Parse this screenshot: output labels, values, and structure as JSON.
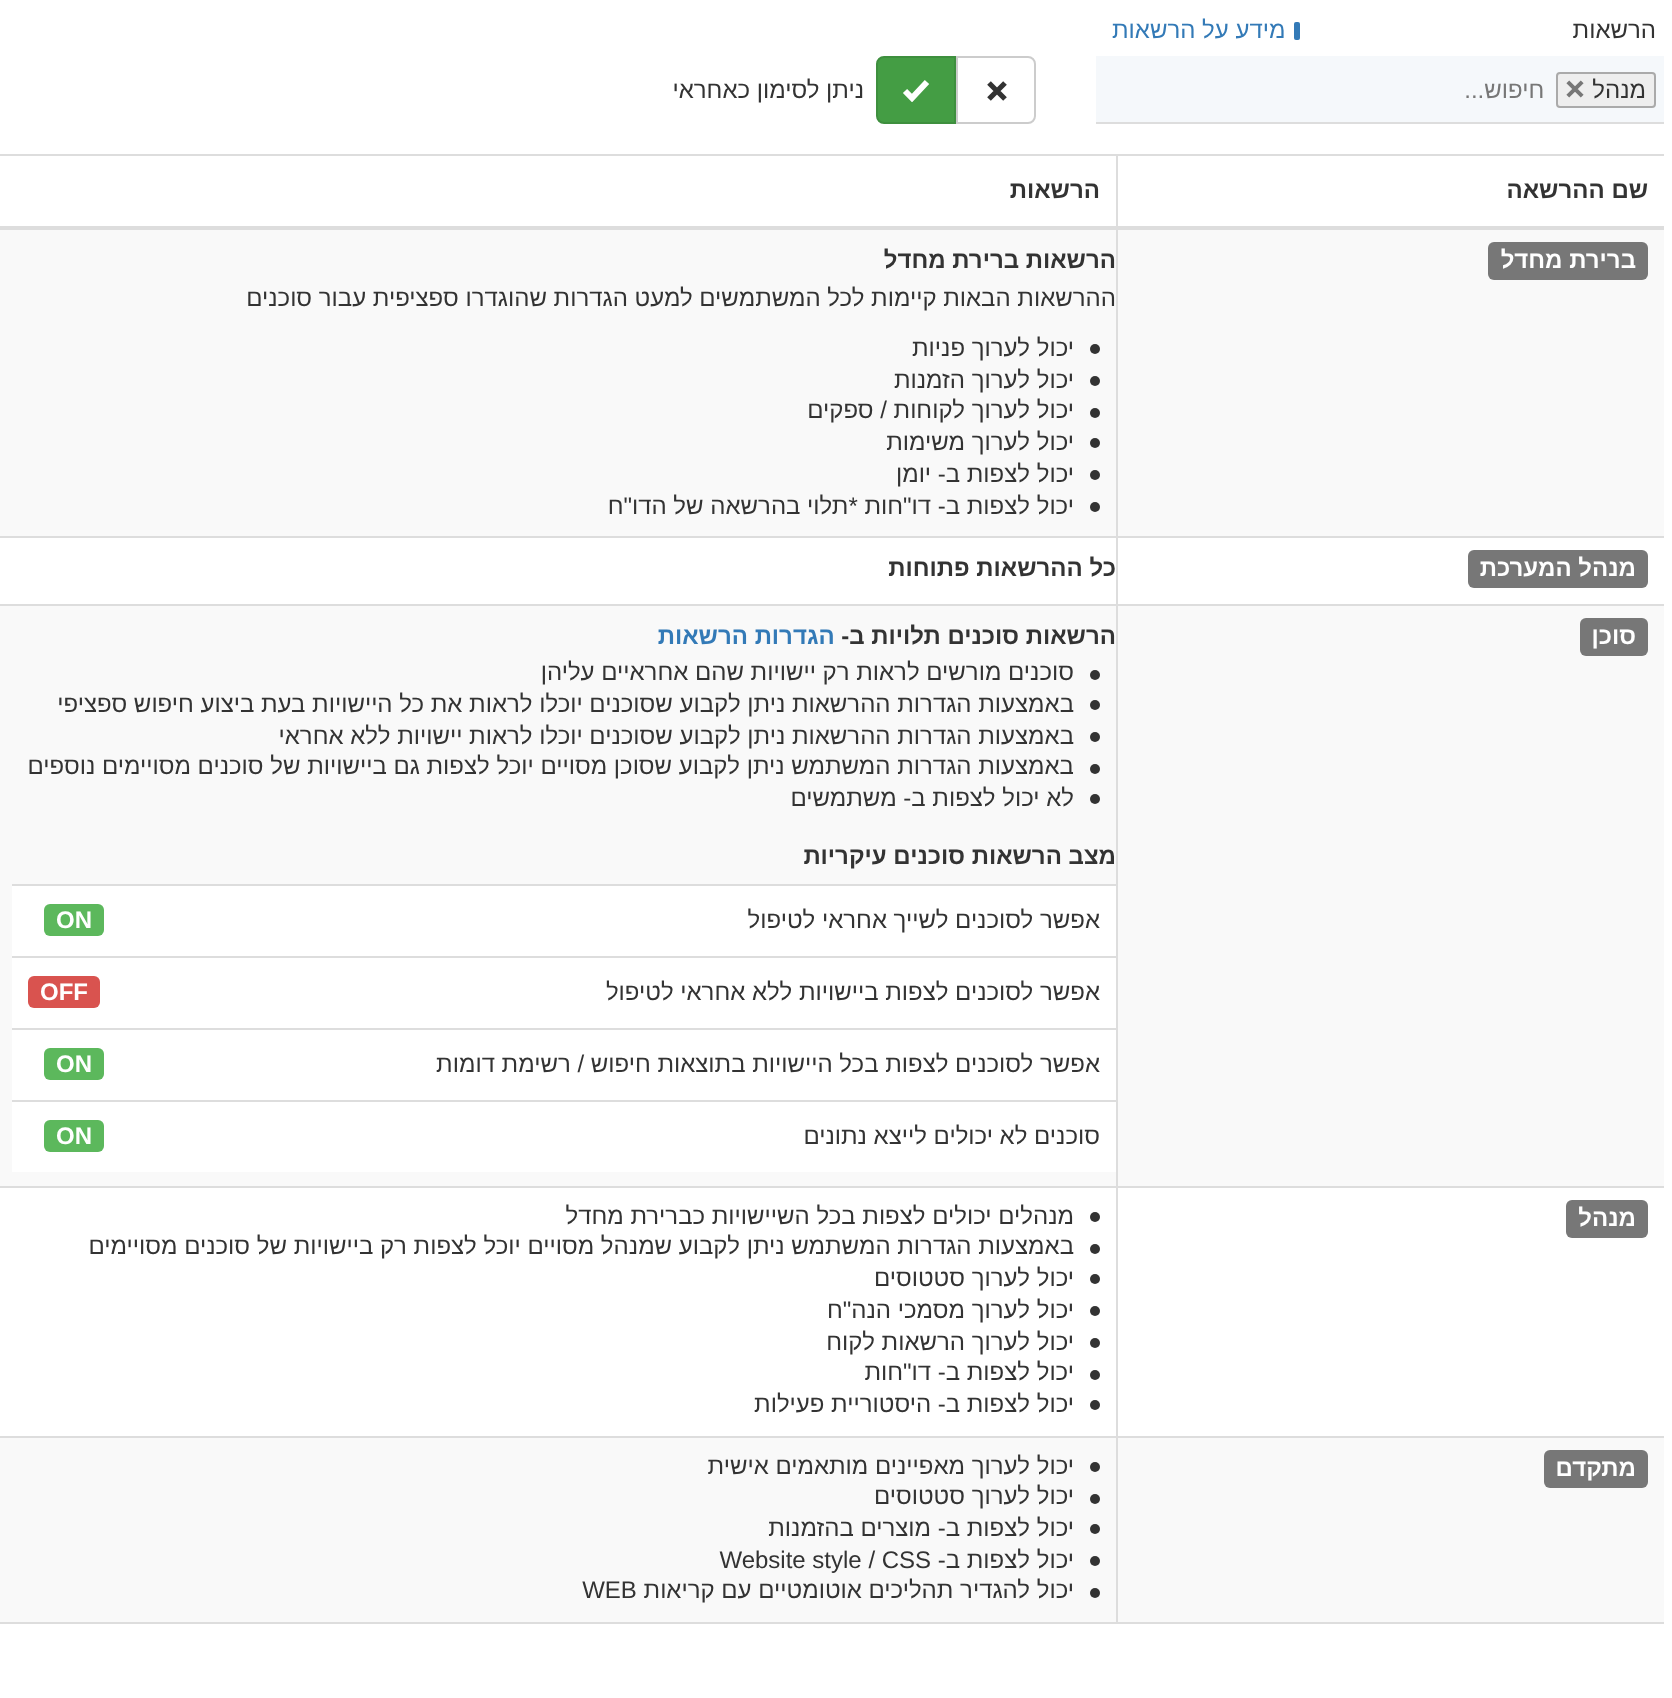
{
  "filter": {
    "label": "הרשאות",
    "info_link": "מידע על הרשאות",
    "tags": [
      {
        "label": "מנהל"
      }
    ],
    "placeholder": "חיפוש..."
  },
  "responsible": {
    "label": "ניתן לסימון כאחראי",
    "options": [
      {
        "kind": "no",
        "selected": false
      },
      {
        "kind": "yes",
        "selected": true
      }
    ]
  },
  "table": {
    "columns": [
      "שם ההרשאה",
      "הרשאות"
    ],
    "rows": [
      {
        "badge": "ברירת מחדל",
        "blocks": [
          {
            "kind": "heading",
            "text": "הרשאות ברירת מחדל"
          },
          {
            "kind": "paragraph",
            "text": "ההרשאות הבאות קיימות לכל המשתמשים למעט הגדרות שהוגדרו ספציפית עבור סוכנים"
          },
          {
            "kind": "list",
            "items": [
              "יכול לערוך פניות",
              "יכול לערוך הזמנות",
              "יכול לערוך לקוחות / ספקים",
              "יכול לערוך משימות",
              "יכול לצפות ב- יומן",
              "יכול לצפות ב- דו\"חות *תלוי בהרשאה של הדו\"ח"
            ]
          }
        ]
      },
      {
        "badge": "מנהל המערכת",
        "blocks": [
          {
            "kind": "heading",
            "text": "כל ההרשאות פתוחות"
          }
        ]
      },
      {
        "badge": "סוכן",
        "blocks": [
          {
            "kind": "heading",
            "text": "הרשאות סוכנים תלויות ב-",
            "link": "הגדרות הרשאות"
          },
          {
            "kind": "list",
            "items": [
              "סוכנים מורשים לראות רק יישויות שהם אחראיים עליהן",
              "באמצעות הגדרות ההרשאות ניתן לקבוע שסוכנים יוכלו לראות את כל היישויות בעת ביצוע חיפוש ספציפי",
              "באמצעות הגדרות ההרשאות ניתן לקבוע שסוכנים יוכלו לראות יישויות ללא אחראי",
              "באמצעות הגדרות המשתמש ניתן לקבוע שסוכן מסויים יוכל לצפות גם ביישויות של סוכנים מסויימים נוספים",
              "לא יכול לצפות ב- משתמשים"
            ]
          },
          {
            "kind": "toggles",
            "title": "מצב הרשאות סוכנים עיקריות",
            "items": [
              {
                "label": "אפשר לסוכנים לשייך אחראי לטיפול",
                "state": "ON",
                "on": true
              },
              {
                "label": "אפשר לסוכנים לצפות ביישויות ללא אחראי לטיפול",
                "state": "OFF",
                "on": false
              },
              {
                "label": "אפשר לסוכנים לצפות בכל היישויות בתוצאות חיפוש / רשימת דומות",
                "state": "ON",
                "on": true
              },
              {
                "label": "סוכנים לא יכולים לייצא נתונים",
                "state": "ON",
                "on": true
              }
            ]
          }
        ]
      },
      {
        "badge": "מנהל",
        "blocks": [
          {
            "kind": "list",
            "items": [
              "מנהלים יכולים לצפות בכל השיישויות כברירת מחדל",
              "באמצעות הגדרות המשתמש ניתן לקבוע שמנהל מסויים יוכל לצפות רק ביישויות של סוכנים מסויימים",
              "יכול לערוך סטטוסים",
              "יכול לערוך מסמכי הנה\"ח",
              "יכול לערוך הרשאות לקוח",
              "יכול לצפות ב- דו\"חות",
              "יכול לצפות ב- היסטוריית פעילות"
            ]
          }
        ]
      },
      {
        "badge": "מתקדם",
        "blocks": [
          {
            "kind": "list",
            "items": [
              "יכול לערוך מאפיינים מותאמים אישית",
              "יכול לערוך סטטוסים",
              "יכול לצפות ב- מוצרים בהזמנות",
              "יכול לצפות ב- Website style / CSS",
              "יכול להגדיר תהליכים אוטומטיים עם קריאות WEB"
            ]
          }
        ]
      }
    ]
  }
}
